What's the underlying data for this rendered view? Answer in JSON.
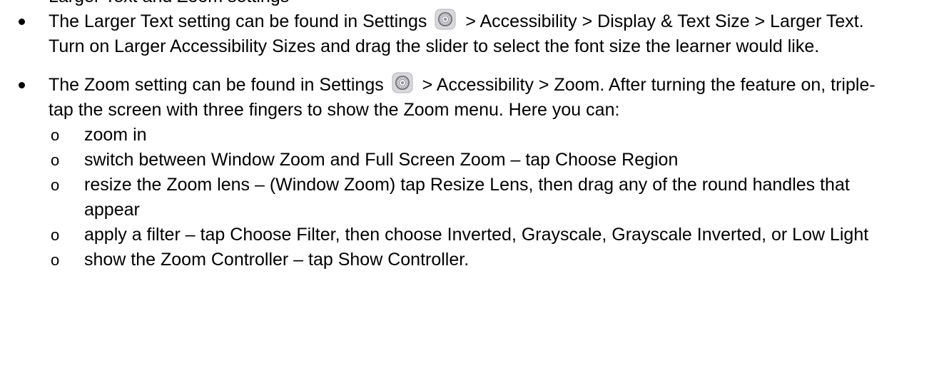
{
  "intro_fragment": "Larger Text and Zoom settings",
  "items": [
    {
      "text_before_icon": "The Larger Text setting can be found in Settings",
      "icon": "settings-gear-icon",
      "text_after_icon": " > Accessibility > Display & Text Size > Larger Text. Turn on Larger Accessibility Sizes and drag the slider to select the font size the learner would like."
    },
    {
      "text_before_icon": "The Zoom setting can be found in Settings",
      "icon": "settings-gear-icon",
      "text_after_icon": " > Accessibility > Zoom. After turning the feature on, triple-tap the screen with three fingers to show the Zoom menu. Here you can:"
    }
  ],
  "sub_marker": "o",
  "sub_items": [
    "zoom in",
    "switch between Window Zoom and Full Screen Zoom – tap Choose Region",
    "resize the Zoom lens – (Window Zoom) tap Resize Lens, then drag any of the round handles that appear",
    "apply a filter – tap Choose Filter, then choose Inverted, Grayscale, Grayscale Inverted, or Low Light",
    "show the Zoom Controller – tap Show Controller."
  ],
  "colors": {
    "text": "#000000",
    "icon_bg": "#d8d8dc",
    "icon_ring": "#8e8e93"
  }
}
